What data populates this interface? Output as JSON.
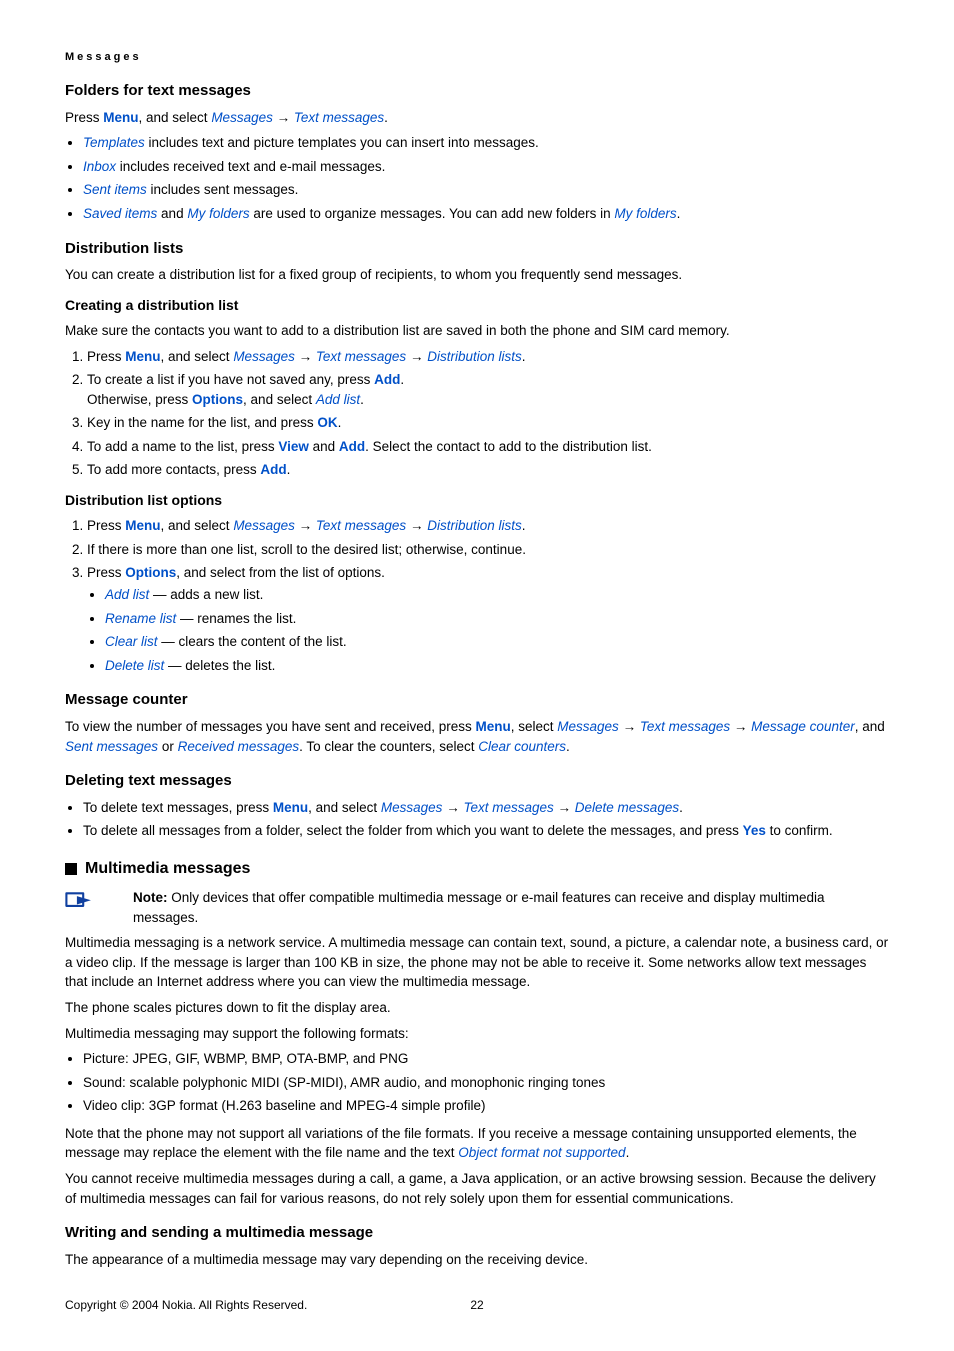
{
  "breadcrumb": "Messages",
  "s1": {
    "heading": "Folders for text messages",
    "intro_a": "Press ",
    "intro_b": "Menu",
    "intro_c": ", and select ",
    "intro_d": "Messages",
    "intro_e": "Text messages",
    "intro_f": ".",
    "b1a": "Templates",
    "b1b": " includes text and picture templates you can insert into messages.",
    "b2a": "Inbox",
    "b2b": " includes received text and e-mail messages.",
    "b3a": "Sent items",
    "b3b": " includes sent messages.",
    "b4a": "Saved items",
    "b4b": " and ",
    "b4c": "My folders",
    "b4d": " are used to organize messages. You can add new folders in ",
    "b4e": "My folders",
    "b4f": "."
  },
  "s2": {
    "heading": "Distribution lists",
    "intro": "You can create a distribution list for a fixed group of recipients, to whom you frequently send messages.",
    "sub1": "Creating a distribution list",
    "sub1intro": "Make sure the contacts you want to add to a distribution list are saved in both the phone and SIM card memory.",
    "o1a": "Press ",
    "o1b": "Menu",
    "o1c": ", and select ",
    "o1d": "Messages",
    "o1e": "Text messages",
    "o1f": "Distribution lists",
    "o1g": ".",
    "o2a": "To create a list if you have not saved any, press ",
    "o2b": "Add",
    "o2c": ".",
    "o2d": "Otherwise, press ",
    "o2e": "Options",
    "o2f": ", and select ",
    "o2g": "Add list",
    "o2h": ".",
    "o3a": "Key in the name for the list, and press ",
    "o3b": "OK",
    "o3c": ".",
    "o4a": "To add a name to the list, press ",
    "o4b": "View",
    "o4c": " and ",
    "o4d": "Add",
    "o4e": ". Select the contact to add to the distribution list.",
    "o5a": "To add more contacts, press ",
    "o5b": "Add",
    "o5c": ".",
    "sub2": "Distribution list options",
    "p1a": "Press ",
    "p1b": "Menu",
    "p1c": ", and select ",
    "p1d": "Messages",
    "p1e": "Text messages",
    "p1f": "Distribution lists",
    "p1g": ".",
    "p2": "If there is more than one list, scroll to the desired list; otherwise, continue.",
    "p3a": "Press ",
    "p3b": "Options",
    "p3c": ", and select from the list of options.",
    "q1a": "Add list",
    "q1b": " — adds a new list.",
    "q2a": "Rename list",
    "q2b": " — renames the list.",
    "q3a": "Clear list",
    "q3b": " — clears the content of the list.",
    "q4a": "Delete list",
    "q4b": " — deletes the list."
  },
  "s3": {
    "heading": "Message counter",
    "a": "To view the number of messages you have sent and received, press ",
    "b": "Menu",
    "c": ", select ",
    "d": "Messages",
    "e": "Text messages",
    "f": "Message counter",
    "g": ", and ",
    "h": "Sent messages",
    "i": " or ",
    "j": "Received messages",
    "k": ". To clear the counters, select ",
    "l": "Clear counters",
    "m": "."
  },
  "s4": {
    "heading": "Deleting text messages",
    "b1a": "To delete text messages, press ",
    "b1b": "Menu",
    "b1c": ", and select ",
    "b1d": "Messages",
    "b1e": "Text messages",
    "b1f": "Delete messages",
    "b1g": ".",
    "b2a": "To delete all messages from a folder, select the folder from which you want to delete the messages, and press ",
    "b2b": "Yes",
    "b2c": " to confirm."
  },
  "s5": {
    "heading": "Multimedia messages",
    "note_label": "Note:",
    "note_text": "  Only devices that offer compatible multimedia message or e-mail features can receive and display multimedia messages.",
    "p1": "Multimedia messaging is a network service. A multimedia message can contain text, sound, a picture, a calendar note, a business card, or a video clip. If the message is larger than 100 KB in size, the phone may not be able to receive it. Some networks allow text messages that include an Internet address where you can view the multimedia message.",
    "p2": "The phone scales pictures down to fit the display area.",
    "p3": "Multimedia messaging may support the following formats:",
    "b1": "Picture: JPEG, GIF, WBMP, BMP, OTA-BMP, and PNG",
    "b2": "Sound: scalable polyphonic MIDI (SP-MIDI), AMR audio, and monophonic ringing tones",
    "b3": "Video clip: 3GP format (H.263 baseline and MPEG-4 simple profile)",
    "p4a": "Note that the phone may not support all variations of the file formats. If you receive a message containing unsupported elements, the message may replace the element with the file name and the text ",
    "p4b": "Object format not supported",
    "p4c": ".",
    "p5": "You cannot receive multimedia messages during a call, a game, a Java application, or an active browsing session. Because the delivery of multimedia messages can fail for various reasons, do not rely solely upon them for essential communications."
  },
  "s6": {
    "heading": "Writing and sending a multimedia message",
    "p1": "The appearance of a multimedia message may vary depending on the receiving device."
  },
  "footer": {
    "copyright": "Copyright © 2004 Nokia. All Rights Reserved.",
    "page": "22"
  },
  "arrow": "→"
}
